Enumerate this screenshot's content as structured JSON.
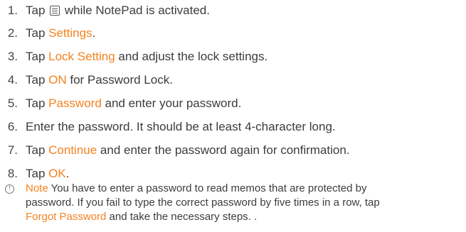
{
  "steps": [
    {
      "number": "1.",
      "before": "Tap ",
      "icon": "menu-icon",
      "after": " while NotePad is activated."
    },
    {
      "number": "2.",
      "before": "Tap ",
      "highlight": "Settings",
      "after": "."
    },
    {
      "number": "3.",
      "before": "Tap ",
      "highlight": "Lock Setting",
      "after": " and adjust the lock settings."
    },
    {
      "number": "4.",
      "before": "Tap ",
      "highlight": "ON",
      "after": " for Password Lock."
    },
    {
      "number": "5.",
      "before": "Tap ",
      "highlight": "Password",
      "after": " and enter your password."
    },
    {
      "number": "6.",
      "text": "Enter the password. It should be at least 4-character long."
    },
    {
      "number": "7.",
      "before": "Tap ",
      "highlight": "Continue",
      "after": " and enter the password again for confirmation."
    },
    {
      "number": "8.",
      "before": "Tap ",
      "highlight": "OK",
      "after": "."
    }
  ],
  "note": {
    "icon": "info-icon",
    "icon_glyph": "!",
    "label": "Note",
    "line1": " You have to enter a password to read memos that are protected by",
    "line2": "password. If you fail to type the correct password by five times in a row, tap",
    "line3_highlight": "Forgot Password",
    "line3_after": " and take the necessary steps. ."
  },
  "colors": {
    "highlight": "#f58220",
    "text": "#3c3c3c"
  }
}
